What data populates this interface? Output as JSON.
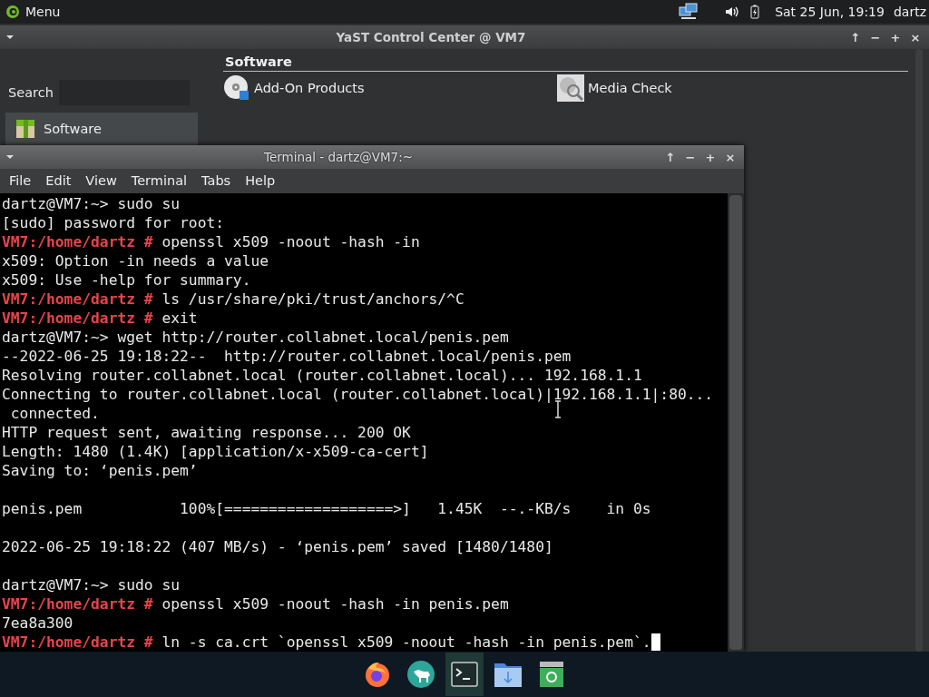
{
  "top_panel": {
    "menu_label": "Menu",
    "date_time": "Sat 25 Jun, 19:19",
    "user": "dartz"
  },
  "yast": {
    "title": "YaST Control Center @ VM7",
    "window_buttons": [
      "↑",
      "−",
      "+",
      "×"
    ],
    "search_label": "Search",
    "categories": [
      {
        "label": "Software",
        "selected": true
      }
    ],
    "section_title": "Software",
    "modules": [
      {
        "label": "Add-On Products",
        "kind": "disc"
      },
      {
        "label": "Media Check",
        "kind": "magnifier"
      }
    ]
  },
  "terminal": {
    "title": "Terminal - dartz@VM7:~",
    "window_buttons": [
      "↑",
      "−",
      "+",
      "×"
    ],
    "menu": [
      "File",
      "Edit",
      "View",
      "Terminal",
      "Tabs",
      "Help"
    ],
    "lines": [
      {
        "kind": "plain",
        "text": "dartz@VM7:~> sudo su"
      },
      {
        "kind": "plain",
        "text": "[sudo] password for root:"
      },
      {
        "kind": "root",
        "prompt": "VM7:/home/dartz #",
        "text": "openssl x509 -noout -hash -in"
      },
      {
        "kind": "plain",
        "text": "x509: Option -in needs a value"
      },
      {
        "kind": "plain",
        "text": "x509: Use -help for summary."
      },
      {
        "kind": "root",
        "prompt": "VM7:/home/dartz #",
        "text": "ls /usr/share/pki/trust/anchors/^C"
      },
      {
        "kind": "root",
        "prompt": "VM7:/home/dartz #",
        "text": "exit"
      },
      {
        "kind": "plain",
        "text": "dartz@VM7:~> wget http://router.collabnet.local/penis.pem"
      },
      {
        "kind": "plain",
        "text": "--2022-06-25 19:18:22--  http://router.collabnet.local/penis.pem"
      },
      {
        "kind": "plain",
        "text": "Resolving router.collabnet.local (router.collabnet.local)... 192.168.1.1"
      },
      {
        "kind": "plain",
        "text": "Connecting to router.collabnet.local (router.collabnet.local)|192.168.1.1|:80..."
      },
      {
        "kind": "plain",
        "text": " connected."
      },
      {
        "kind": "plain",
        "text": "HTTP request sent, awaiting response... 200 OK"
      },
      {
        "kind": "plain",
        "text": "Length: 1480 (1.4K) [application/x-x509-ca-cert]"
      },
      {
        "kind": "plain",
        "text": "Saving to: ‘penis.pem’"
      },
      {
        "kind": "blank"
      },
      {
        "kind": "plain",
        "text": "penis.pem           100%[===================>]   1.45K  --.-KB/s    in 0s"
      },
      {
        "kind": "blank"
      },
      {
        "kind": "plain",
        "text": "2022-06-25 19:18:22 (407 MB/s) - ‘penis.pem’ saved [1480/1480]"
      },
      {
        "kind": "blank"
      },
      {
        "kind": "plain",
        "text": "dartz@VM7:~> sudo su"
      },
      {
        "kind": "root",
        "prompt": "VM7:/home/dartz #",
        "text": "openssl x509 -noout -hash -in penis.pem"
      },
      {
        "kind": "plain",
        "text": "7ea8a300"
      },
      {
        "kind": "root",
        "prompt": "VM7:/home/dartz #",
        "text": "ln -s ca.crt `openssl x509 -noout -hash -in penis.pem`."
      }
    ],
    "cursor": true
  },
  "dock": [
    {
      "kind": "browser",
      "selected": false
    },
    {
      "kind": "animal",
      "selected": false
    },
    {
      "kind": "terminal",
      "selected": true
    },
    {
      "kind": "downloads",
      "selected": false
    },
    {
      "kind": "trash",
      "selected": false
    }
  ]
}
